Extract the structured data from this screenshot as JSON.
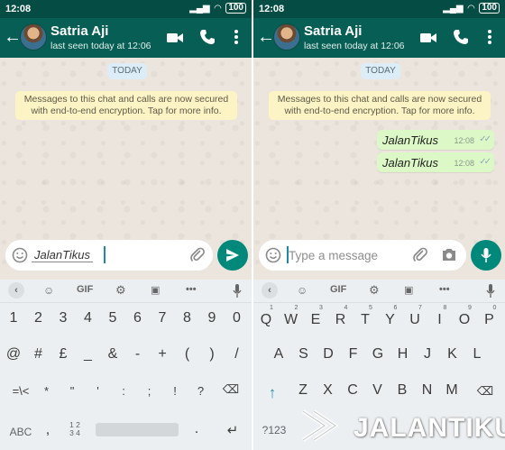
{
  "status": {
    "time": "12:08",
    "battery": "100"
  },
  "chat": {
    "contact_name": "Satria Aji",
    "last_seen": "last seen today at 12:06",
    "date_chip": "TODAY",
    "encryption_notice_line1": "Messages to this chat and calls are now secured",
    "encryption_notice_line2": "with end-to-end encryption. Tap for more info.",
    "messages": [
      {
        "text": "JalanTikus",
        "time": "12:08",
        "status": "read"
      },
      {
        "text": "JalanTikus",
        "time": "12:08",
        "status": "read"
      }
    ]
  },
  "composer": {
    "left_value": "JalanTikus",
    "right_placeholder": "Type a message"
  },
  "keyboard_toolbar": {
    "gif": "GIF",
    "more": "•••"
  },
  "keyboard_left": {
    "row1": [
      "1",
      "2",
      "3",
      "4",
      "5",
      "6",
      "7",
      "8",
      "9",
      "0"
    ],
    "row2": [
      "@",
      "#",
      "£",
      "_",
      "&",
      "-",
      "+",
      "(",
      ")",
      "/"
    ],
    "row3": [
      "=\\<",
      "*",
      "\"",
      "'",
      ":",
      ";",
      "!",
      "?"
    ],
    "row4_abc": "ABC",
    "row4_pager_top": "1 2",
    "row4_pager_bottom": "3 4",
    "row4_comma": ",",
    "row4_dot": "."
  },
  "keyboard_right": {
    "row1": [
      "Q",
      "W",
      "E",
      "R",
      "T",
      "Y",
      "U",
      "I",
      "O",
      "P"
    ],
    "row1_hints": [
      "1",
      "2",
      "3",
      "4",
      "5",
      "6",
      "7",
      "8",
      "9",
      "0"
    ],
    "row2": [
      "A",
      "S",
      "D",
      "F",
      "G",
      "H",
      "J",
      "K",
      "L"
    ],
    "row3": [
      "Z",
      "X",
      "C",
      "V",
      "B",
      "N",
      "M"
    ],
    "row4_symbols": "?123"
  },
  "watermark": {
    "text": "JALANTIKUS"
  },
  "colors": {
    "header": "#075e54",
    "statusbar": "#054d44",
    "accent": "#00897b",
    "bubble": "#dcf8c6",
    "notice": "#fcf4c4"
  }
}
